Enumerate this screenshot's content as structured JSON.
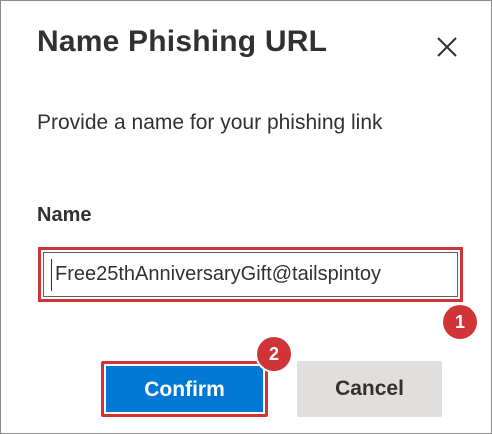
{
  "dialog": {
    "title": "Name Phishing URL",
    "close_icon": "close-icon",
    "subtitle": "Provide a name for your phishing link",
    "field_label": "Name",
    "name_value": "Free25thAnniversaryGift@tailspintoy"
  },
  "annotations": {
    "badge_1": "1",
    "badge_2": "2"
  },
  "buttons": {
    "confirm_label": "Confirm",
    "cancel_label": "Cancel"
  },
  "colors": {
    "accent": "#0078d4",
    "highlight": "#d13438",
    "neutral_button": "#e1dfdd",
    "text": "#323130"
  }
}
